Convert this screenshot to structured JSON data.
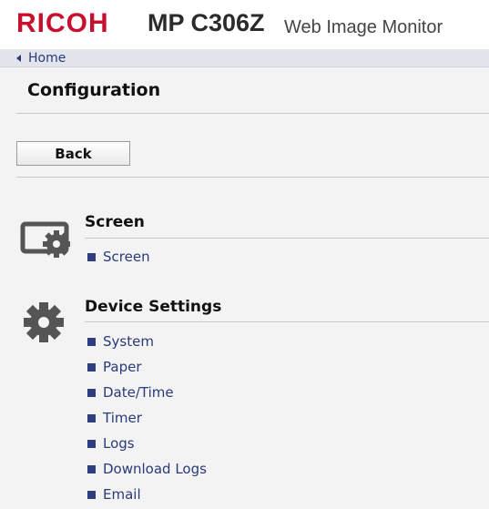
{
  "header": {
    "logo": "RICOH",
    "model": "MP C306Z",
    "app_title": "Web Image Monitor"
  },
  "nav": {
    "home": "Home"
  },
  "page": {
    "title": "Configuration",
    "back_label": "Back"
  },
  "sections": [
    {
      "title": "Screen",
      "icon": "screen-settings-icon",
      "items": [
        "Screen"
      ]
    },
    {
      "title": "Device Settings",
      "icon": "gear-icon",
      "items": [
        "System",
        "Paper",
        "Date/Time",
        "Timer",
        "Logs",
        "Download Logs",
        "Email"
      ]
    }
  ],
  "colors": {
    "brand": "#c8102e",
    "link": "#2a3a7a",
    "bullet": "#2e3f80",
    "background": "#f3f3f3"
  }
}
